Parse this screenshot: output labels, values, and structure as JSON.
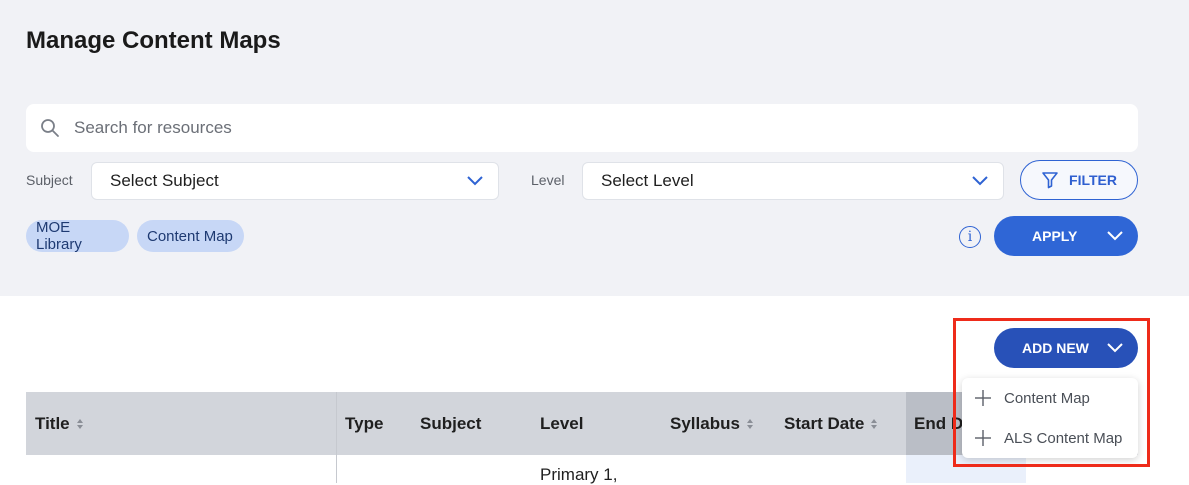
{
  "page": {
    "title": "Manage Content Maps"
  },
  "search": {
    "placeholder": "Search for resources",
    "icon": "search-icon"
  },
  "filters": {
    "subject_label": "Subject",
    "subject_value": "Select Subject",
    "level_label": "Level",
    "level_value": "Select Level",
    "filter_button": "FILTER",
    "apply_button": "APPLY"
  },
  "chips": [
    "MOE Library",
    "Content Map"
  ],
  "info_icon": "i",
  "add_new": {
    "label": "ADD NEW",
    "menu": [
      "Content Map",
      "ALS Content Map"
    ]
  },
  "table": {
    "columns": [
      "Title",
      "Type",
      "Subject",
      "Level",
      "Syllabus",
      "Start Date",
      "End Da"
    ],
    "rows": [
      {
        "level": "Primary 1,"
      }
    ]
  },
  "colors": {
    "accent": "#2f66d6",
    "add_new": "#2851b8",
    "highlight": "#ee2b1a",
    "chip": "#c7d7f6"
  }
}
